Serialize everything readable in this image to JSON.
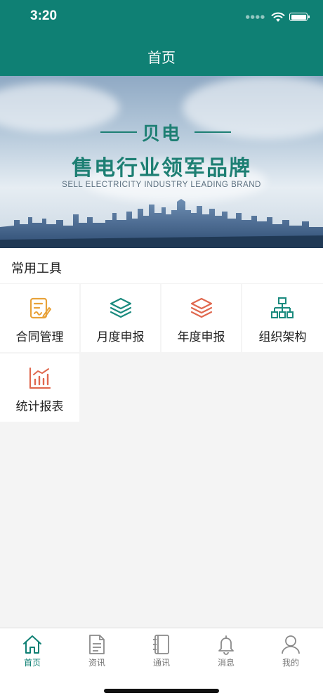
{
  "status_bar": {
    "time": "3:20"
  },
  "header": {
    "title": "首页"
  },
  "banner": {
    "brand": "贝电",
    "slogan": "售电行业领军品牌",
    "subtitle": "SELL ELECTRICITY INDUSTRY LEADING BRAND"
  },
  "section": {
    "title": "常用工具"
  },
  "tools": [
    {
      "label": "合同管理",
      "icon": "contract-icon",
      "color": "#e8a23a"
    },
    {
      "label": "月度申报",
      "icon": "layers-icon",
      "color": "#1a8a7e"
    },
    {
      "label": "年度申报",
      "icon": "layers-icon",
      "color": "#e0684f"
    },
    {
      "label": "组织架构",
      "icon": "org-chart-icon",
      "color": "#1a8a7e"
    },
    {
      "label": "统计报表",
      "icon": "chart-icon",
      "color": "#e0684f"
    }
  ],
  "tabbar": {
    "items": [
      {
        "label": "首页",
        "icon": "home-icon",
        "active": true
      },
      {
        "label": "资讯",
        "icon": "document-icon",
        "active": false
      },
      {
        "label": "通讯",
        "icon": "contacts-book-icon",
        "active": false
      },
      {
        "label": "消息",
        "icon": "bell-icon",
        "active": false
      },
      {
        "label": "我的",
        "icon": "user-icon",
        "active": false
      }
    ]
  },
  "colors": {
    "primary": "#0f8074",
    "orange": "#e8a23a",
    "red": "#e0684f",
    "background": "#f4f4f4"
  }
}
